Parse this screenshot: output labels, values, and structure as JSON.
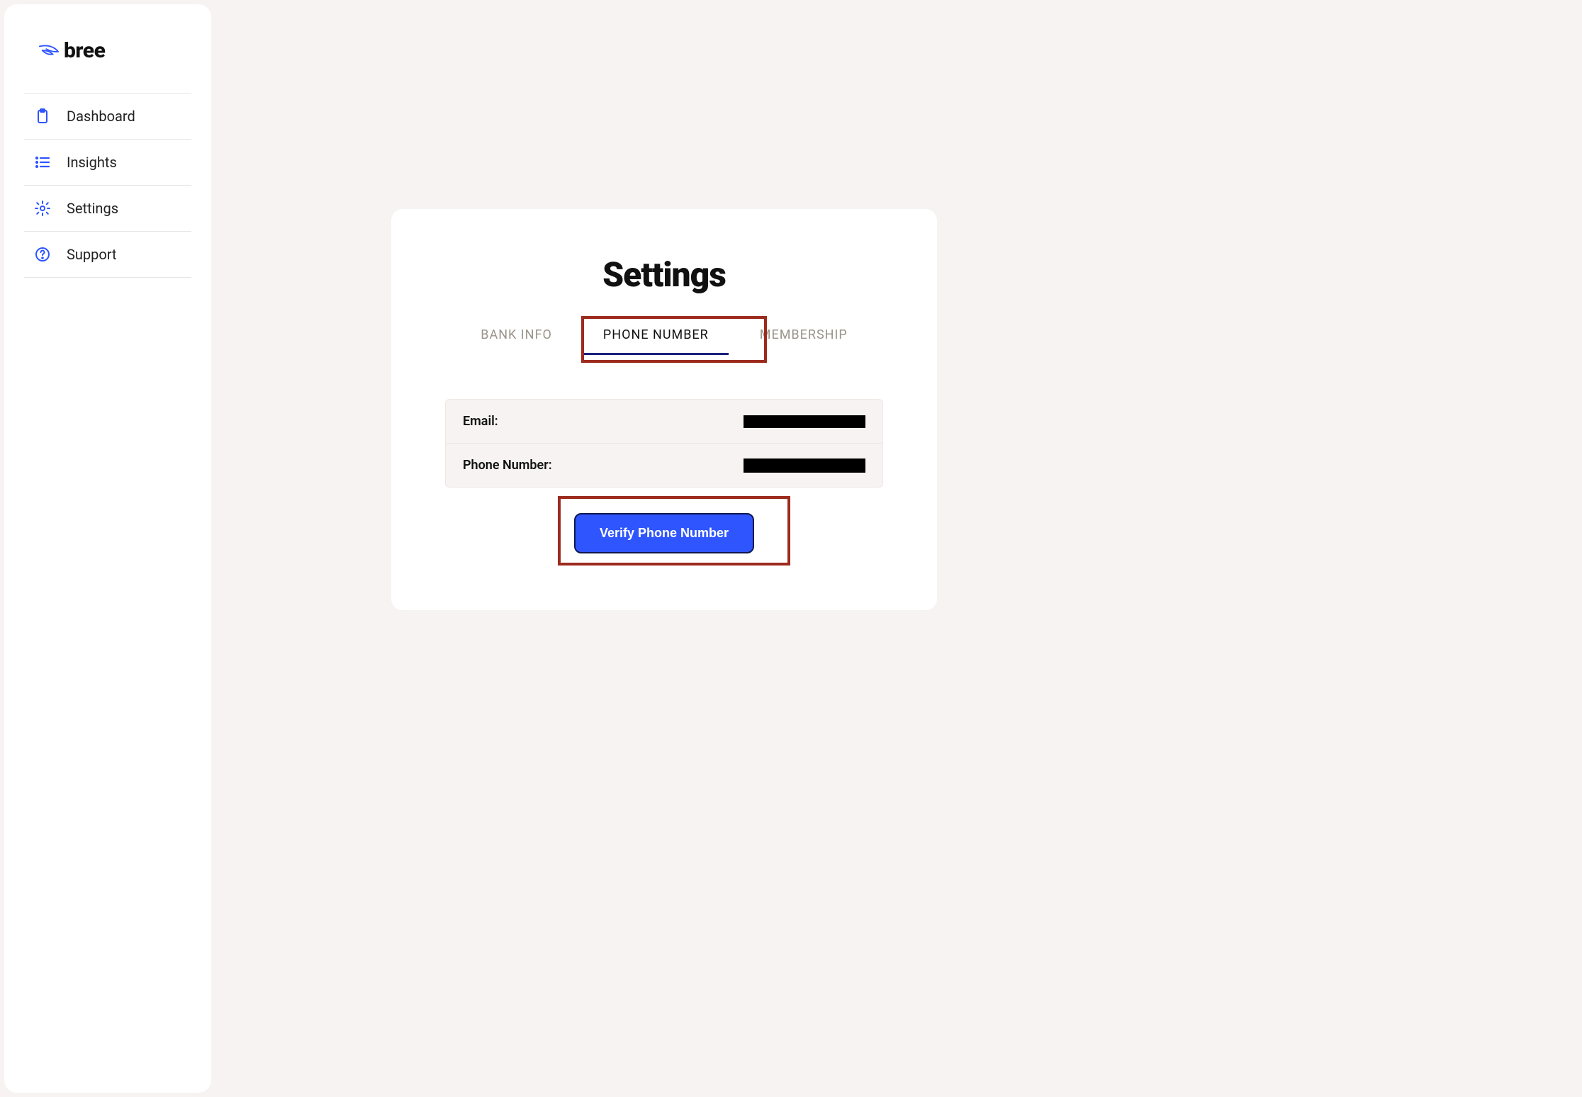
{
  "brand": {
    "name": "bree"
  },
  "sidebar": {
    "items": [
      {
        "label": "Dashboard"
      },
      {
        "label": "Insights"
      },
      {
        "label": "Settings"
      },
      {
        "label": "Support"
      }
    ]
  },
  "page": {
    "title": "Settings",
    "tabs": [
      {
        "label": "BANK INFO"
      },
      {
        "label": "PHONE NUMBER"
      },
      {
        "label": "MEMBERSHIP"
      }
    ],
    "fields": {
      "email_label": "Email:",
      "phone_label": "Phone Number:"
    },
    "verify_button": "Verify Phone Number"
  }
}
